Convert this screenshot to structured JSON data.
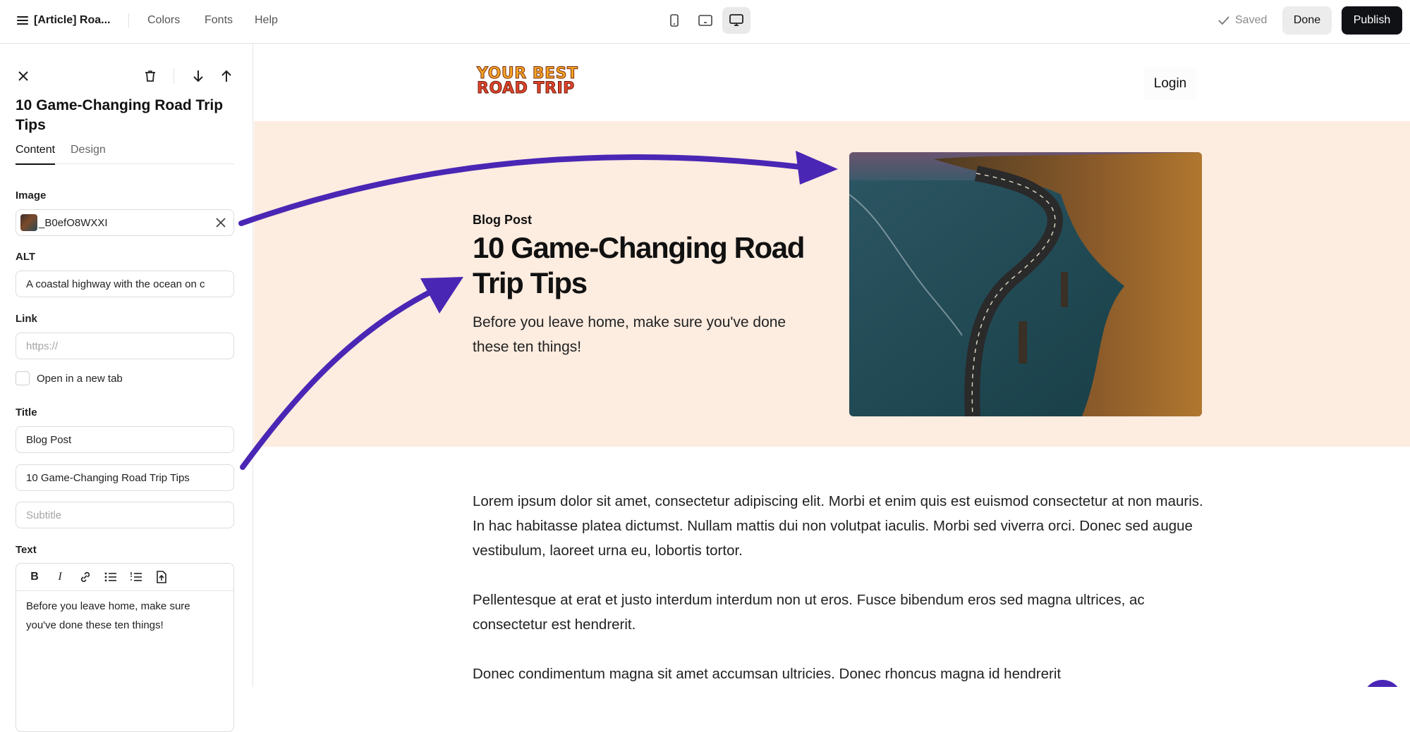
{
  "topbar": {
    "doc_title": "[Article] Roa...",
    "menu": [
      "Colors",
      "Fonts",
      "Help"
    ],
    "devices": [
      "mobile-icon",
      "tablet-icon",
      "desktop-icon"
    ],
    "active_device": "desktop-icon",
    "saved_label": "Saved",
    "done_label": "Done",
    "publish_label": "Publish"
  },
  "panel": {
    "title": "10 Game-Changing Road Trip Tips",
    "tabs": [
      "Content",
      "Design"
    ],
    "active_tab": "Content",
    "image_label": "Image",
    "image_value": "_B0efO8WXXI",
    "alt_label": "ALT",
    "alt_value": "A coastal highway with the ocean on c",
    "link_label": "Link",
    "link_placeholder": "https://",
    "new_tab_label": "Open in a new tab",
    "title_label": "Title",
    "kicker_value": "Blog Post",
    "title_value": "10 Game-Changing Road Trip Tips",
    "subtitle_placeholder": "Subtitle",
    "text_label": "Text",
    "text_value": "Before you leave home, make sure you've done these ten things!"
  },
  "site": {
    "logo_line1": "YOUR BEST",
    "logo_line2": "ROAD TRIP",
    "login_label": "Login",
    "hero_kicker": "Blog Post",
    "hero_title": "10 Game-Changing Road Trip Tips",
    "hero_subtitle": "Before you leave home, make sure you've done these ten things!",
    "paragraphs": [
      "Lorem ipsum dolor sit amet, consectetur adipiscing elit. Morbi et enim quis est euismod consectetur at non mauris. In hac habitasse platea dictumst. Nullam mattis dui non volutpat iaculis. Morbi sed viverra orci. Donec sed augue vestibulum, laoreet urna eu, lobortis tortor.",
      " Pellentesque at erat et justo interdum interdum non ut eros. Fusce bibendum eros sed magna ultrices, ac consectetur est hendrerit.",
      "Donec condimentum magna sit amet accumsan ultricies. Donec rhoncus magna id hendrerit"
    ]
  },
  "colors": {
    "hero_background": "#fdece0",
    "arrow": "#4a26b5",
    "publish_button": "#0f1115"
  }
}
